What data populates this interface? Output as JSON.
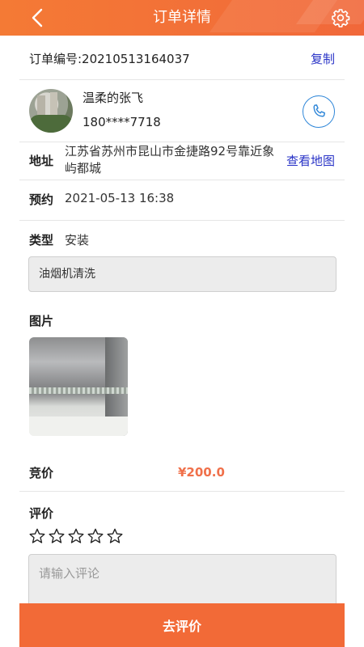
{
  "header": {
    "title": "订单详情",
    "back_icon": "chevron-left-icon",
    "settings_icon": "gear-icon"
  },
  "order": {
    "number_label": "订单编号:20210513164037",
    "copy_label": "复制"
  },
  "customer": {
    "name": "温柔的张飞",
    "phone": "180****7718",
    "call_icon": "phone-icon"
  },
  "address": {
    "label": "地址",
    "value": "江苏省苏州市昆山市金捷路92号靠近象屿都城",
    "map_link": "查看地图"
  },
  "appointment": {
    "label": "预约",
    "value": "2021-05-13 16:38"
  },
  "service_type": {
    "label": "类型",
    "value": "安装",
    "remark": "油烟机清洗"
  },
  "pictures": {
    "label": "图片"
  },
  "bid": {
    "label": "竞价",
    "value": "¥200.0"
  },
  "review": {
    "label": "评价",
    "stars_total": 5,
    "stars_selected": 0,
    "placeholder": "请输入评论",
    "submit_label": "去评价"
  },
  "colors": {
    "header": "#f47a35",
    "accent": "#f26a37",
    "link": "#2a34c7",
    "phone_icon": "#2e86d8",
    "price": "#f0704a"
  }
}
